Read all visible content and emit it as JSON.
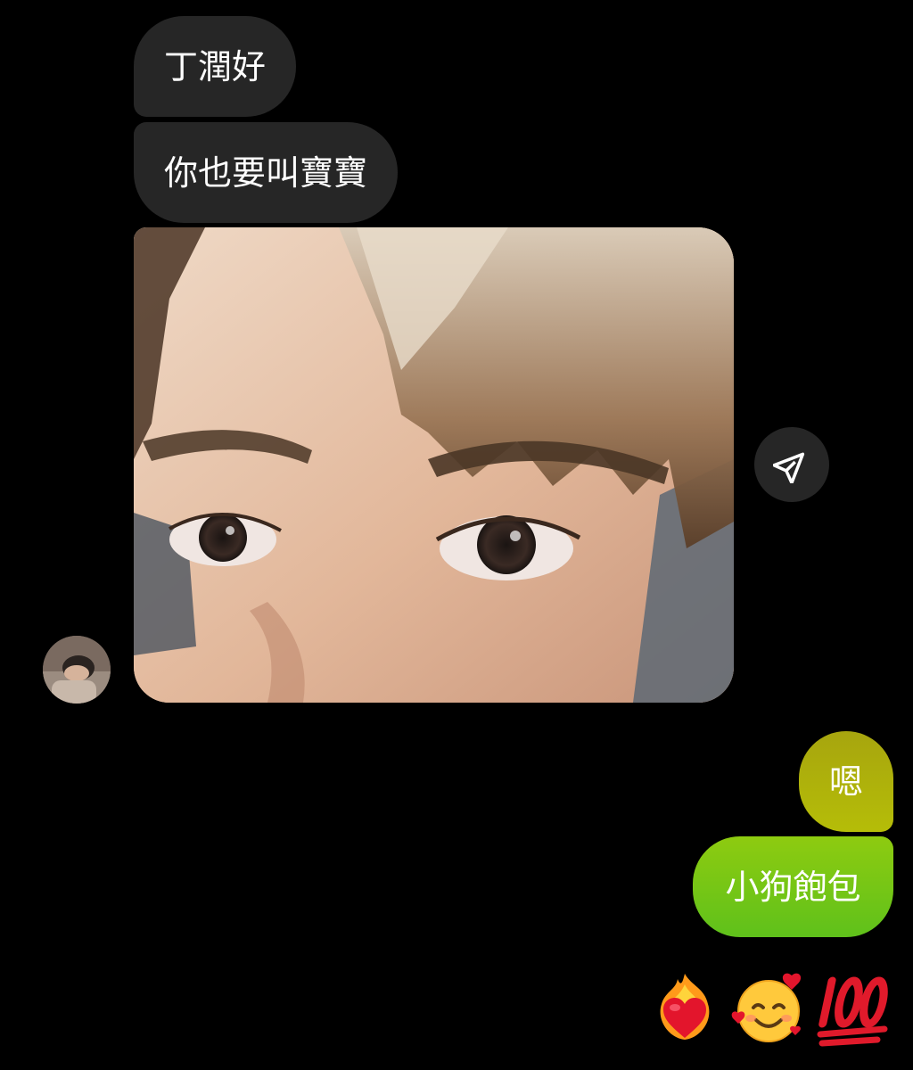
{
  "conversation": {
    "incoming": [
      {
        "text": "丁潤好"
      },
      {
        "text": "你也要叫寶寶"
      }
    ],
    "outgoing": [
      {
        "text": "嗯"
      },
      {
        "text": "小狗飽包"
      }
    ],
    "reactions": [
      "fire-heart-emoji",
      "smiling-face-with-hearts-emoji",
      "hundred-points-emoji"
    ]
  },
  "colors": {
    "background": "#000000",
    "incoming_bubble": "#262626",
    "outgoing_bubble_top": "#a7a50e",
    "outgoing_bubble_bottom": "#5fc11b"
  },
  "icons": {
    "share": "paper-plane-icon",
    "avatar": "profile-avatar"
  }
}
